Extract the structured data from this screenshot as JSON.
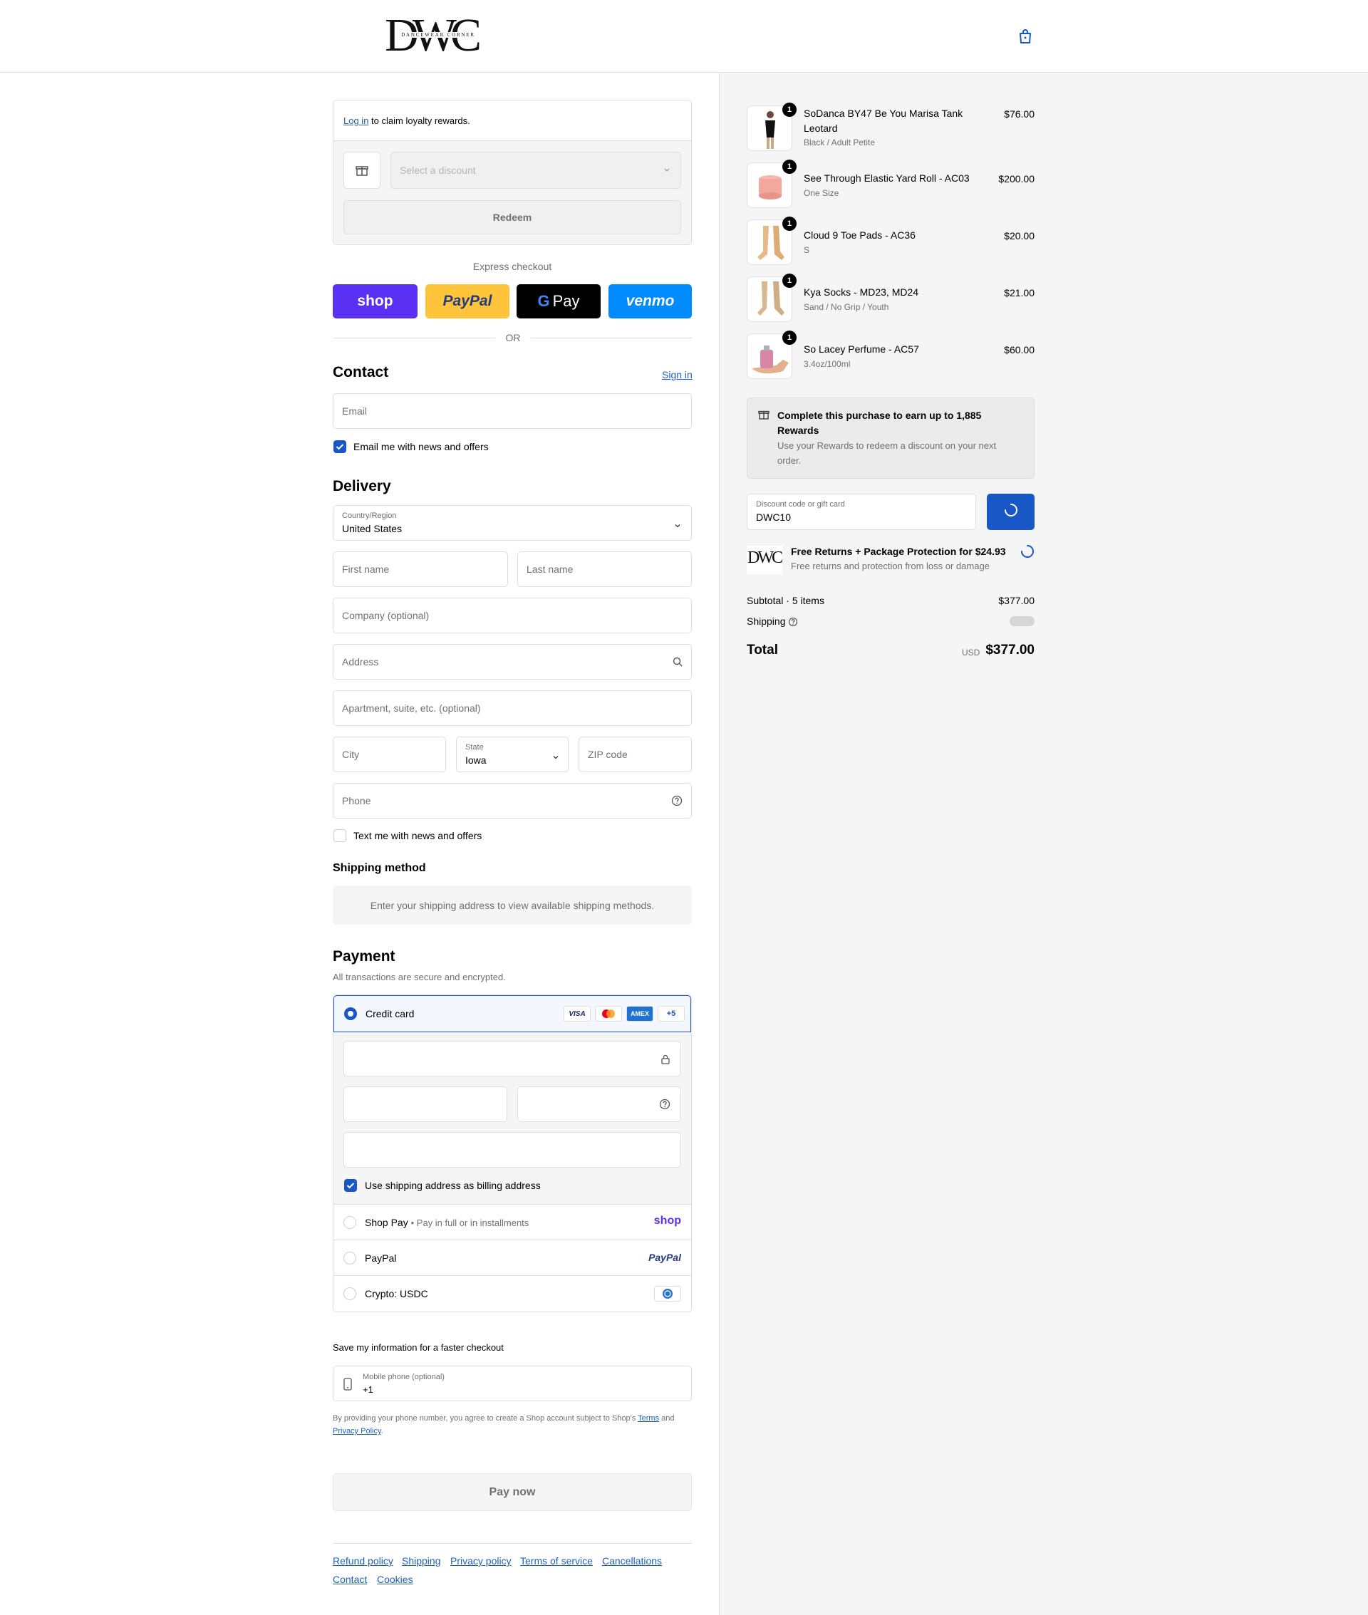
{
  "header": {
    "logo_text": "DWC",
    "logo_subtext": "DANCEWEAR CORNER",
    "cart_icon": "shopping-bag-icon"
  },
  "loyalty": {
    "login_link": "Log in",
    "login_suffix": "to claim loyalty rewards.",
    "discount_placeholder": "Select a discount",
    "redeem_label": "Redeem"
  },
  "express": {
    "title": "Express checkout",
    "or_label": "OR",
    "buttons": [
      "shop",
      "PayPal",
      "Pay",
      "venmo"
    ]
  },
  "contact": {
    "title": "Contact",
    "sign_in": "Sign in",
    "email_placeholder": "Email",
    "news_label": "Email me with news and offers",
    "news_checked": true
  },
  "delivery": {
    "title": "Delivery",
    "country_label": "Country/Region",
    "country_value": "United States",
    "first_name": "First name",
    "last_name": "Last name",
    "company": "Company (optional)",
    "address": "Address",
    "apartment": "Apartment, suite, etc. (optional)",
    "city": "City",
    "state_label": "State",
    "state_value": "Iowa",
    "zip": "ZIP code",
    "phone": "Phone",
    "text_label": "Text me with news and offers",
    "text_checked": false
  },
  "shipping_method": {
    "title": "Shipping method",
    "message": "Enter your shipping address to view available shipping methods."
  },
  "payment": {
    "title": "Payment",
    "subtitle": "All transactions are secure and encrypted.",
    "credit_card": "Credit card",
    "card_brands": [
      "VISA",
      "mastercard",
      "AMEX",
      "+5"
    ],
    "billing_label": "Use shipping address as billing address",
    "billing_checked": true,
    "shop_pay": "Shop Pay",
    "shop_pay_sub": "Pay in full or in installments",
    "shop_pay_logo": "shop",
    "paypal": "PayPal",
    "paypal_logo": "PayPal",
    "crypto": "Crypto: USDC"
  },
  "save_info": {
    "title": "Save my information for a faster checkout",
    "mobile_label": "Mobile phone (optional)",
    "mobile_value": "+1",
    "legal_1": "By providing your phone number, you agree to create a Shop account subject to Shop's",
    "terms": "Terms",
    "and": "and",
    "privacy": "Privacy Policy",
    "period": "."
  },
  "pay_now": "Pay now",
  "footer_links": [
    "Refund policy",
    "Shipping",
    "Privacy policy",
    "Terms of service",
    "Cancellations",
    "Contact",
    "Cookies"
  ],
  "cart": {
    "items": [
      {
        "qty": "1",
        "name": "SoDanca BY47 Be You Marisa Tank Leotard",
        "variant": "Black / Adult Petite",
        "price": "$76.00"
      },
      {
        "qty": "1",
        "name": "See Through Elastic Yard Roll - AC03",
        "variant": "One Size",
        "price": "$200.00"
      },
      {
        "qty": "1",
        "name": "Cloud 9 Toe Pads - AC36",
        "variant": "S",
        "price": "$20.00"
      },
      {
        "qty": "1",
        "name": "Kya Socks - MD23, MD24",
        "variant": "Sand / No Grip / Youth",
        "price": "$21.00"
      },
      {
        "qty": "1",
        "name": "So Lacey Perfume - AC57",
        "variant": "3.4oz/100ml",
        "price": "$60.00"
      }
    ],
    "rewards_title": "Complete this purchase to earn up to 1,885 Rewards",
    "rewards_sub": "Use your Rewards to redeem a discount on your next order.",
    "discount_label": "Discount code or gift card",
    "discount_value": "DWC10",
    "protection_title": "Free Returns + Package Protection for $24.93",
    "protection_sub": "Free returns and protection from loss or damage",
    "subtotal_label": "Subtotal · 5 items",
    "subtotal_value": "$377.00",
    "shipping_label": "Shipping",
    "total_label": "Total",
    "currency": "USD",
    "total_value": "$377.00"
  },
  "colors": {
    "accent": "#1957c7",
    "shop_purple": "#5a31f4",
    "paypal_yellow": "#ffc439",
    "venmo_blue": "#008cff"
  }
}
